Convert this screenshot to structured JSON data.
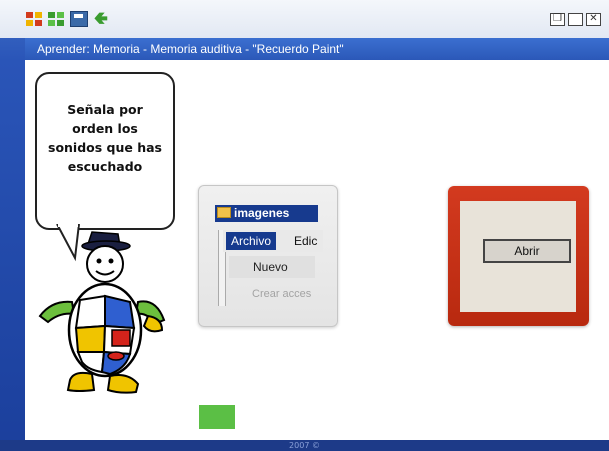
{
  "window": {
    "title": "Aprender: Memoria - Memoria auditiva - \"Recuerdo Paint\"",
    "footer_text": "2007 ©",
    "controls": [
      "restore-icon",
      "maximize-icon",
      "close-icon"
    ]
  },
  "toolbar_icons": [
    "grid-red-icon",
    "grid-green-icon",
    "save-icon",
    "back-arrow-icon"
  ],
  "bubble": {
    "text": "Señala por orden los sonidos que has escuchado"
  },
  "folder_window": {
    "title": "imagenes",
    "menu": {
      "archivo": "Archivo",
      "edicion": "Edic"
    },
    "items": {
      "nuevo": "Nuevo",
      "crear": "Crear acces"
    }
  },
  "open_dialog": {
    "button_label": "Abrir"
  },
  "colors": {
    "accent_blue": "#2b58b8",
    "dialog_red": "#c8321a",
    "green_square": "#5bbf45"
  }
}
